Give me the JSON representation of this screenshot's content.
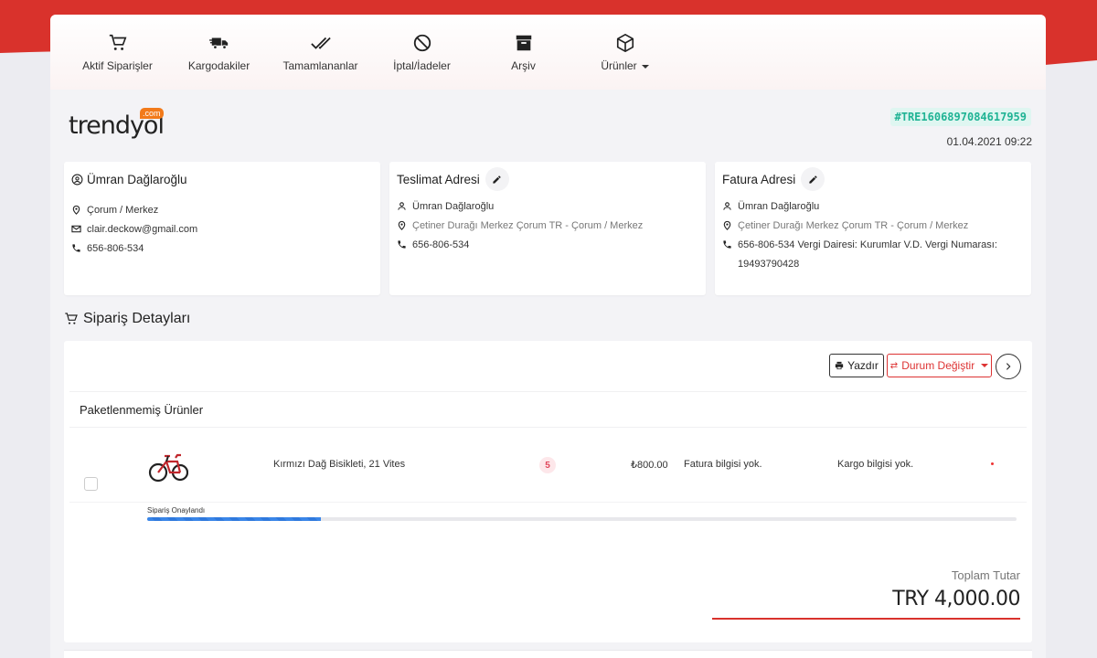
{
  "nav": {
    "items": [
      {
        "label": "Aktif Siparişler",
        "icon": "cart-icon"
      },
      {
        "label": "Kargodakiler",
        "icon": "truck-icon"
      },
      {
        "label": "Tamamlananlar",
        "icon": "double-check-icon"
      },
      {
        "label": "İptal/İadeler",
        "icon": "block-icon"
      },
      {
        "label": "Arşiv",
        "icon": "archive-icon"
      },
      {
        "label": "Ürünler",
        "icon": "box-icon"
      }
    ]
  },
  "brand": {
    "name": "trendyol",
    "tld": ".com",
    "color": "#f27a1a"
  },
  "order": {
    "id": "#TRE1606897084617959",
    "date": "01.04.2021 09:22"
  },
  "customer": {
    "name": "Ümran Dağlaroğlu",
    "location": "Çorum / Merkez",
    "email": "clair.deckow@gmail.com",
    "phone": "656-806-534"
  },
  "shipping": {
    "title": "Teslimat Adresi",
    "name": "Ümran Dağlaroğlu",
    "address": "Çetiner Durağı Merkez Çorum TR - Çorum / Merkez",
    "phone": "656-806-534"
  },
  "billing": {
    "title": "Fatura Adresi",
    "name": "Ümran Dağlaroğlu",
    "address": "Çetiner Durağı Merkez Çorum TR - Çorum / Merkez",
    "phone_tax": "656-806-534 Vergi Dairesi: Kurumlar V.D. Vergi Numarası: 19493790428"
  },
  "details": {
    "title": "Sipariş Detayları",
    "print_label": "Yazdır",
    "status_change_label": "Durum Değiştir",
    "section_label": "Paketlenmemiş Ürünler",
    "product": {
      "name": "Kırmızı Dağ Bisikleti, 21 Vites",
      "quantity": "5",
      "price": "₺800.00",
      "invoice": "Fatura bilgisi yok.",
      "cargo": "Kargo bilgisi yok.",
      "status": "Sipariş Onaylandı",
      "progress": 0.2
    },
    "total_label": "Toplam Tutar",
    "total_value": "TRY 4,000.00"
  },
  "colors": {
    "accent": "#d9322c",
    "order_id": "#1fb394",
    "progress": "#3a86e8"
  }
}
